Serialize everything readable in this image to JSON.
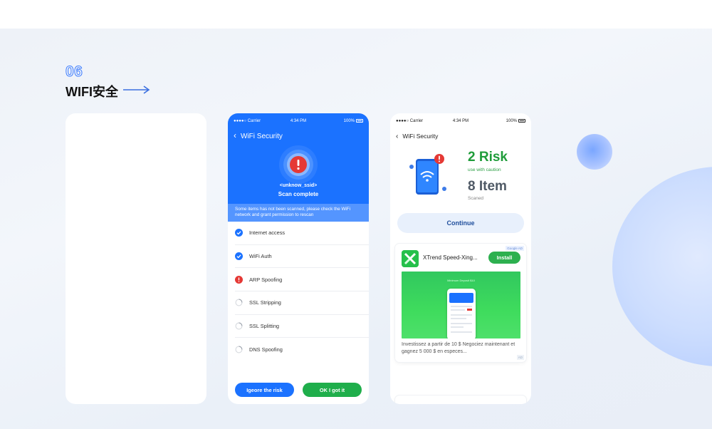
{
  "section": {
    "number": "06",
    "title": "WIFI安全"
  },
  "colors": {
    "accent_blue": "#1b72ff",
    "accent_green": "#1fae4b",
    "risk_red": "#e53935",
    "risk_green": "#1f9c3a"
  },
  "status_bar": {
    "carrier": "Carrier",
    "time": "4:34 PM",
    "battery": "100%"
  },
  "screen1": {
    "nav_title": "WiFi Security",
    "ssid": "<unknow_ssid>",
    "status": "Scan complete",
    "notice": "Some items has not been scanned, please check the WiFi network and grant permission to rescan",
    "checks": [
      {
        "label": "Internet access",
        "state": "checked",
        "icon": "check-circle-icon"
      },
      {
        "label": "WiFi Auth",
        "state": "checked",
        "icon": "check-circle-icon"
      },
      {
        "label": "ARP Spoofing",
        "state": "risk",
        "icon": "alert-circle-icon"
      },
      {
        "label": "SSL Stripping",
        "state": "pending",
        "icon": "spinner-icon"
      },
      {
        "label": "SSL Splitting",
        "state": "pending",
        "icon": "spinner-icon"
      },
      {
        "label": "DNS Spoofing",
        "state": "pending",
        "icon": "spinner-icon"
      }
    ],
    "ignore_button": "Igeore the risk",
    "ok_button": "OK I got it"
  },
  "screen2": {
    "nav_title": "WiFi Security",
    "risk_count": "2 Risk",
    "risk_caption": "use with caution",
    "item_count": "8 Item",
    "item_caption": "Scaned",
    "continue_button": "Continue",
    "ad": {
      "tag": "Google AD",
      "app_name": "XTrend Speed-Xing...",
      "install_button": "Install",
      "banner_title": "Minimum Deposit $10",
      "description": "Investissez a partir de 10 $ Negociez maintenant et gagnez  5 000 $ en especes...",
      "corner_label": "AD"
    }
  }
}
